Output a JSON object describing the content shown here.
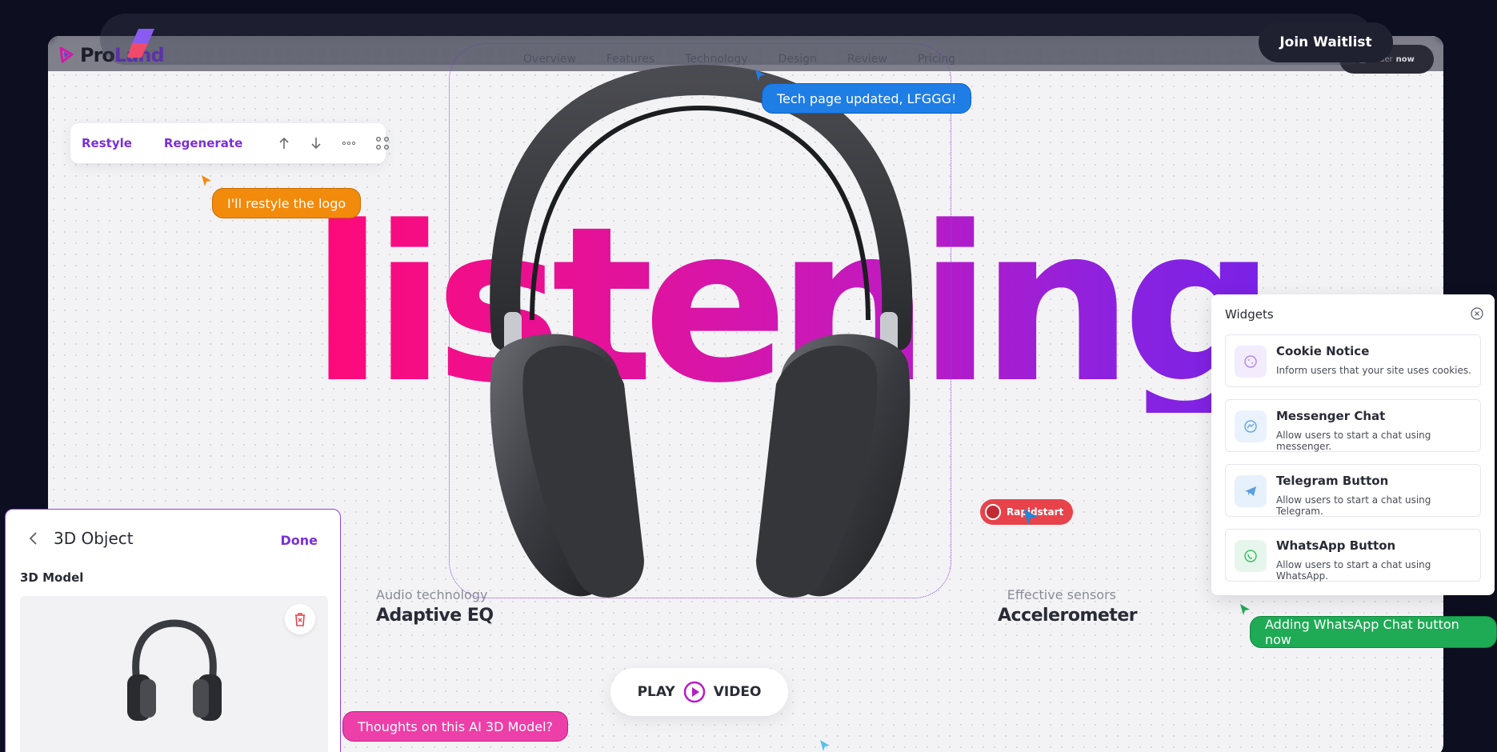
{
  "site": {
    "logo_prefix": "Pro",
    "logo_suffix": "Land",
    "nav": [
      "Overview",
      "Features",
      "Technology",
      "Design",
      "Review",
      "Pricing"
    ],
    "order_button": {
      "prefix": "Order",
      "suffix": "now"
    },
    "hero_word": "listening",
    "spec_left": {
      "label": "Audio technology",
      "value": "Adaptive EQ"
    },
    "spec_right": {
      "label": "Effective sensors",
      "value": "Accelerometer"
    },
    "play_left": "PLAY",
    "play_right": "VIDEO"
  },
  "header": {
    "join_label": "Join Waitlist"
  },
  "toolbar": {
    "restyle": "Restyle",
    "regenerate": "Regenerate"
  },
  "collaborators": {
    "tech_note": "Tech page updated, LFGGG!",
    "logo_note": "I'll restyle the logo",
    "rapidstart": "Rapidstart",
    "whatsapp_note": "Adding WhatsApp Chat button now",
    "model_note": "Thoughts on this AI 3D Model?"
  },
  "widgets": {
    "title": "Widgets",
    "items": [
      {
        "name": "Cookie Notice",
        "desc": "Inform users that your site uses cookies.",
        "icon": "cookie-icon"
      },
      {
        "name": "Messenger Chat",
        "desc": "Allow users to start a chat using messenger.",
        "icon": "messenger-icon"
      },
      {
        "name": "Telegram Button",
        "desc": "Allow users to start a chat using Telegram.",
        "icon": "telegram-icon"
      },
      {
        "name": "WhatsApp Button",
        "desc": "Allow users to start a chat using WhatsApp.",
        "icon": "whatsapp-icon"
      }
    ]
  },
  "object_panel": {
    "title": "3D Object",
    "done": "Done",
    "section": "3D Model"
  },
  "colors": {
    "accent": "#7b2fd9",
    "tech_bubble": "#1f7de6",
    "logo_bubble": "#f28a0c",
    "rapid_bubble": "#e8434b",
    "whatsapp_bubble": "#1faa55",
    "model_bubble": "#ec3fa8"
  }
}
